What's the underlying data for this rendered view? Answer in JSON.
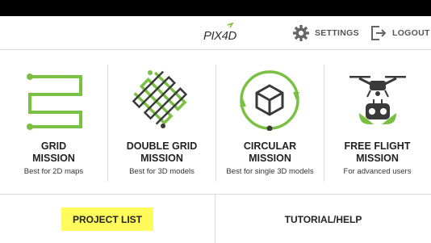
{
  "header": {
    "logo_text": "PIX4D",
    "settings_label": "SETTINGS",
    "logout_label": "LOGOUT"
  },
  "missions": [
    {
      "title_line1": "GRID",
      "title_line2": "MISSION",
      "subtitle": "Best for 2D maps",
      "icon": "grid-mission-icon"
    },
    {
      "title_line1": "DOUBLE GRID",
      "title_line2": "MISSION",
      "subtitle": "Best for 3D models",
      "icon": "double-grid-mission-icon"
    },
    {
      "title_line1": "CIRCULAR",
      "title_line2": "MISSION",
      "subtitle": "Best for single 3D models",
      "icon": "circular-mission-icon"
    },
    {
      "title_line1": "FREE FLIGHT",
      "title_line2": "MISSION",
      "subtitle": "For advanced users",
      "icon": "free-flight-drone-icon"
    }
  ],
  "bottom": {
    "project_list_label": "PROJECT LIST",
    "tutorial_label": "TUTORIAL/HELP"
  },
  "colors": {
    "accent_green": "#7ac143",
    "highlight_yellow": "#fffb5a",
    "dark_gray": "#3a3a3a"
  }
}
